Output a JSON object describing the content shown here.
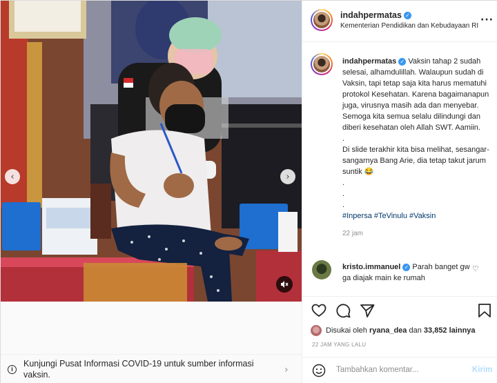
{
  "post": {
    "username": "indahpermatas",
    "location": "Kementerian Pendidikan dan Kebudayaan RI"
  },
  "caption": {
    "username": "indahpermatas",
    "lines": [
      "Vaksin tahap 2 sudah selesai, alhamdulillah. Walaupun sudah di Vaksin, tapi tetap saja kita harus mematuhi protokol Kesehatan. Karena bagaimanapun juga, virusnya masih ada dan menyebar. Semoga kita semua selalu dilindungi dan diberi kesehatan oleh Allah SWT. Aamiin.",
      ".",
      "Di slide terakhir kita bisa melihat, sesangar-sangarnya Bang Arie, dia tetap takut jarum suntik 😂",
      ".",
      ".",
      "."
    ],
    "hashtags": "#Inpersa #TeVinulu #Vaksin",
    "time": "22 jam"
  },
  "comment": {
    "username": "kristo.immanuel",
    "text": "Parah banget gw ga diajak main ke rumah"
  },
  "likes": {
    "prefix": "Disukai oleh",
    "user": "ryana_dea",
    "middle": "dan",
    "count": "33,852",
    "suffix": "lainnya"
  },
  "time_ago": "22 JAM YANG LALU",
  "add_comment": {
    "placeholder": "Tambahkan komentar...",
    "post_label": "Kirim"
  },
  "covid_banner": {
    "text": "Kunjungi Pusat Informasi COVID-19 untuk sumber informasi vaksin."
  },
  "icons": {
    "verified": "verified-badge-icon",
    "more": "more-options-icon",
    "like": "heart-icon",
    "comment": "comment-icon",
    "share": "paper-plane-icon",
    "save": "bookmark-icon",
    "emoji": "smiley-icon",
    "info": "info-icon",
    "mute": "muted-speaker-icon"
  },
  "colors": {
    "verified": "#3897f0",
    "link": "#00376b",
    "post_disabled": "#b2dffc",
    "muted_text": "#8e8e8e"
  }
}
